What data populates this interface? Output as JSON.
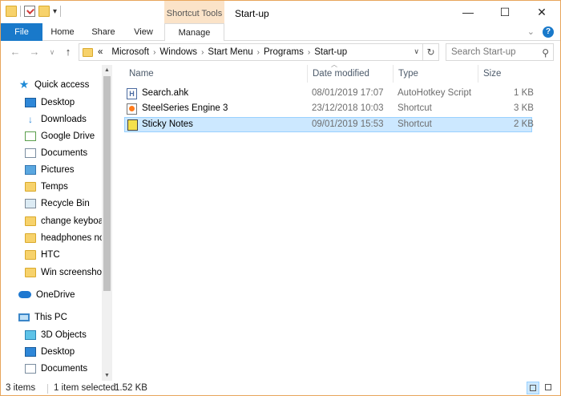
{
  "window": {
    "title": "Start-up",
    "context_tab_group": "Shortcut Tools",
    "controls": {
      "minimize": "—",
      "maximize": "☐",
      "close": "✕"
    }
  },
  "ribbon": {
    "tabs": {
      "file": "File",
      "home": "Home",
      "share": "Share",
      "view": "View",
      "manage": "Manage"
    },
    "help": "?",
    "expand": "⌄"
  },
  "address": {
    "overflow": "«",
    "crumbs": [
      "Microsoft",
      "Windows",
      "Start Menu",
      "Programs",
      "Start-up"
    ],
    "separator": "›",
    "dropdown": "∨",
    "refresh": "↻"
  },
  "search": {
    "placeholder": "Search Start-up",
    "icon": "search-icon"
  },
  "nav_buttons": {
    "back": "←",
    "forward": "→",
    "recent": "∨",
    "up": "↑"
  },
  "sidebar": {
    "items": [
      {
        "label": "Quick access",
        "icon": "star-icon"
      },
      {
        "label": "Desktop",
        "icon": "desktop-icon",
        "pinned": true
      },
      {
        "label": "Downloads",
        "icon": "downloads-icon",
        "pinned": true
      },
      {
        "label": "Google Drive",
        "icon": "google-drive-icon",
        "pinned": true
      },
      {
        "label": "Documents",
        "icon": "documents-icon",
        "pinned": true
      },
      {
        "label": "Pictures",
        "icon": "pictures-icon",
        "pinned": true
      },
      {
        "label": "Temps",
        "icon": "folder-icon",
        "pinned": true
      },
      {
        "label": "Recycle Bin",
        "icon": "recycle-bin-icon",
        "pinned": true
      },
      {
        "label": "change keyboard",
        "icon": "folder-icon"
      },
      {
        "label": "headphones not",
        "icon": "folder-icon"
      },
      {
        "label": "HTC",
        "icon": "folder-icon"
      },
      {
        "label": "Win screenshots",
        "icon": "folder-icon"
      },
      {
        "label": "OneDrive",
        "icon": "onedrive-icon"
      },
      {
        "label": "This PC",
        "icon": "this-pc-icon"
      },
      {
        "label": "3D Objects",
        "icon": "3d-objects-icon"
      },
      {
        "label": "Desktop",
        "icon": "desktop-icon"
      },
      {
        "label": "Documents",
        "icon": "documents-icon"
      }
    ],
    "pin_glyph": "📌"
  },
  "columns": {
    "name": "Name",
    "date": "Date modified",
    "type": "Type",
    "size": "Size"
  },
  "files": [
    {
      "name": "Search.ahk",
      "date": "08/01/2019 17:07",
      "type": "AutoHotkey Script",
      "size": "1 KB",
      "icon": "ahk-file-icon",
      "selected": false
    },
    {
      "name": "SteelSeries Engine 3",
      "date": "23/12/2018 10:03",
      "type": "Shortcut",
      "size": "3 KB",
      "icon": "steelseries-shortcut-icon",
      "selected": false
    },
    {
      "name": "Sticky Notes",
      "date": "09/01/2019 15:53",
      "type": "Shortcut",
      "size": "2 KB",
      "icon": "sticky-notes-shortcut-icon",
      "selected": true
    }
  ],
  "status": {
    "count": "3 items",
    "selection": "1 item selected",
    "selection_size": "1.52 KB"
  },
  "colors": {
    "accent": "#1979ca",
    "selection_bg": "#cce8ff",
    "selection_border": "#99d1ff",
    "context_tab": "#fbe3c8",
    "window_border": "#e8a55b"
  }
}
